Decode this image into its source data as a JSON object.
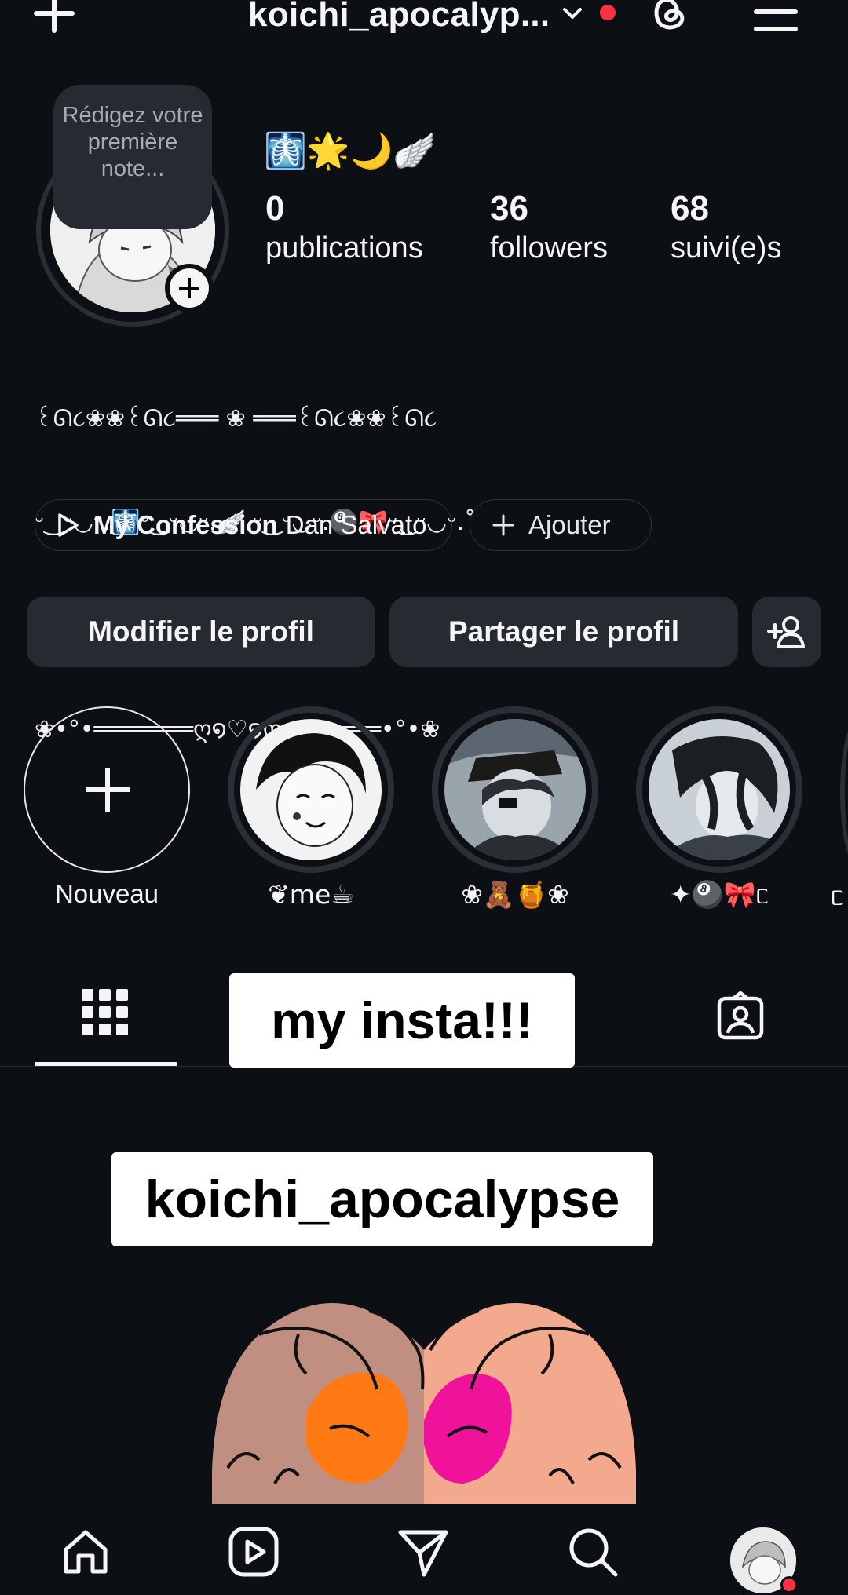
{
  "header": {
    "username": "koichi_apocalyp...",
    "threads_icon": "threads-icon",
    "menu_icon": "hamburger-menu-icon",
    "notification_color": "#ff3040"
  },
  "profile": {
    "note_placeholder": "Rédigez votre première note...",
    "bio_emojis": "🩻🌟🌙🪽",
    "stats": [
      {
        "value": "0",
        "label": "publications"
      },
      {
        "value": "36",
        "label": "followers"
      },
      {
        "value": "68",
        "label": "suivi(e)s"
      }
    ],
    "bio_lines": [
      "꒰ᘏ૮❀❀꒰ᘏ૮═══ ❀ ═══꒰ᘏ૮❀❀꒰ᘏ૮",
      "ᵕ‿ᵕ◡ᵕ.🩻ᵕ‿ᵕ◡ᵕ.🪽 ᵕ‿ᵕ◡ᵕ.🎱🎀ᵕ‿ᵕ◡ᵕ.˚",
      ".˚｡ .˚  ★ ˚. ˚☆˚  ˚｡ .",
      "❀•°•═══════ღ໑♡໑ღ═══════•°•❀"
    ]
  },
  "music": {
    "title": "My Confession",
    "artist": "Dan Salvato"
  },
  "add_link": "Ajouter",
  "buttons": {
    "edit": "Modifier le profil",
    "share": "Partager le profil"
  },
  "highlights": [
    {
      "label": "Nouveau"
    },
    {
      "label": "❦me☕︎"
    },
    {
      "label": "❀🧸🍯❀"
    },
    {
      "label": "✦🎱🎀ᥴ"
    },
    {
      "label": "ᥴ"
    }
  ],
  "captions": {
    "line1": "my insta!!!",
    "line2": "koichi_apocalypse"
  },
  "nav": [
    "home-icon",
    "reels-icon",
    "send-icon",
    "search-icon",
    "profile-avatar"
  ]
}
